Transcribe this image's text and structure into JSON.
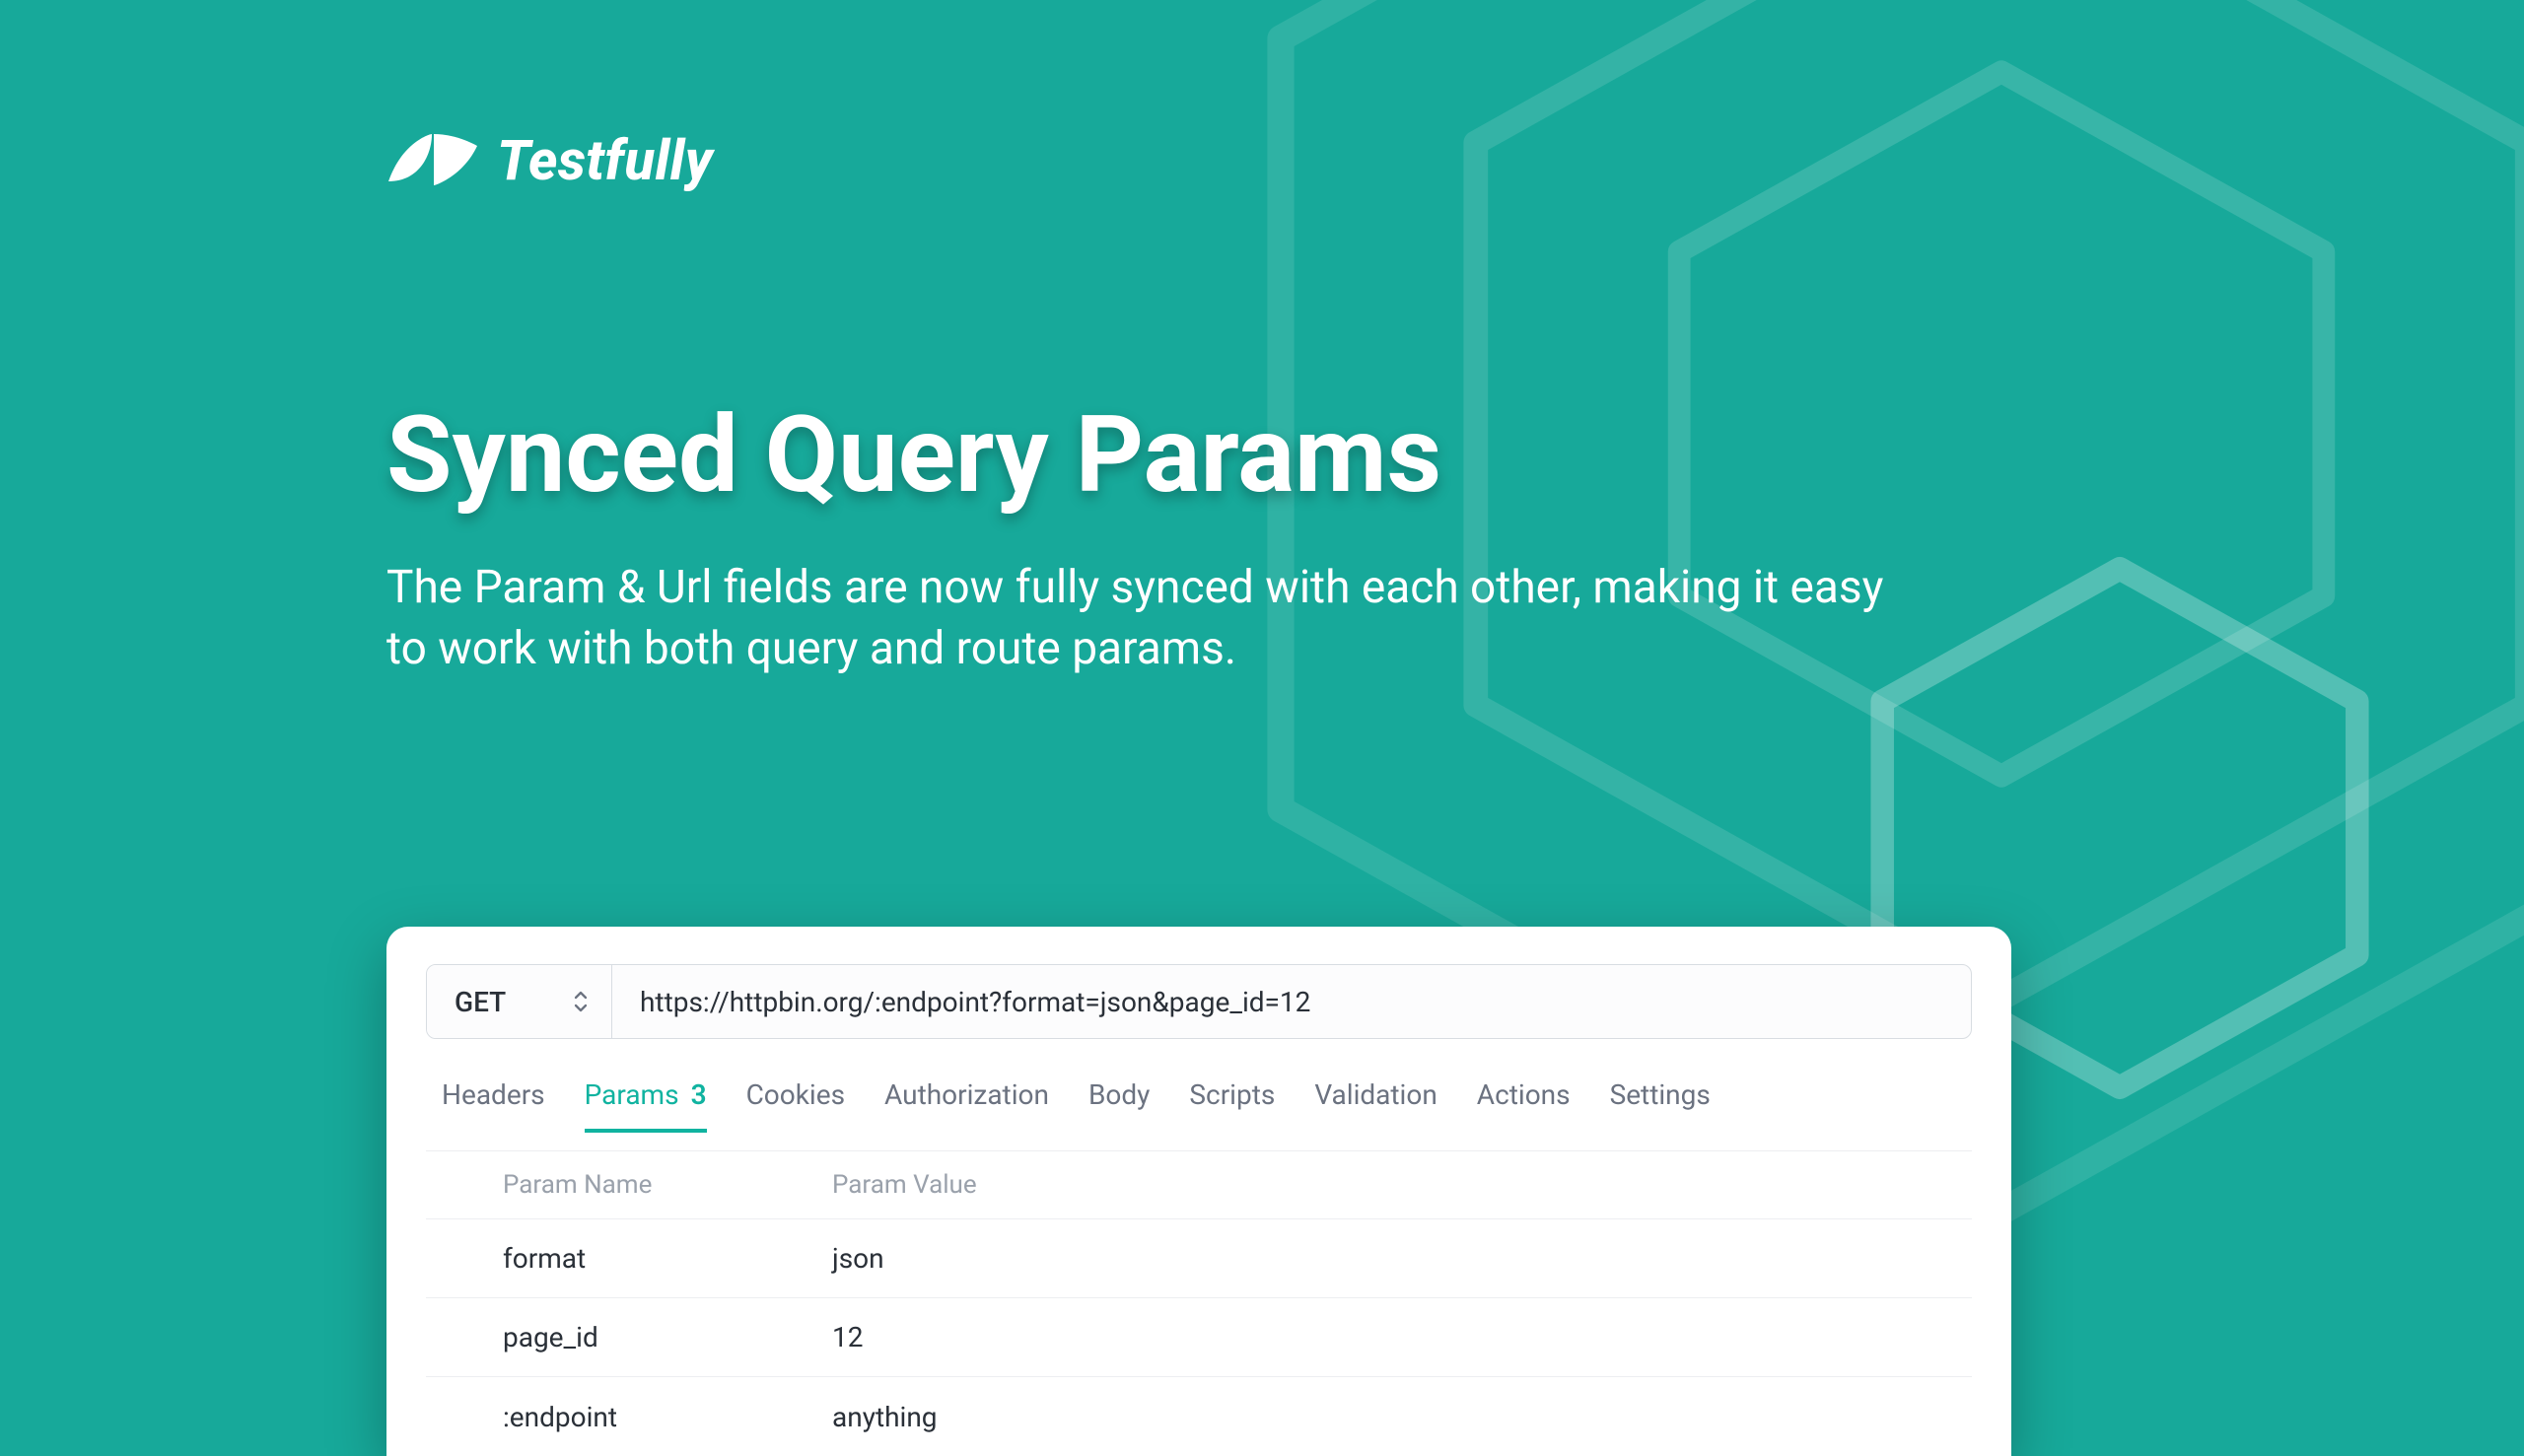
{
  "brand": {
    "name": "Testfully"
  },
  "headline": "Synced Query Params",
  "subcopy": "The Param & Url fields are now fully synced with each other, making it easy to work with both query and route params.",
  "request": {
    "method": "GET",
    "url": "https://httpbin.org/:endpoint?format=json&page_id=12"
  },
  "tabs": {
    "items": [
      {
        "label": "Headers"
      },
      {
        "label": "Params",
        "count": "3",
        "active": true
      },
      {
        "label": "Cookies"
      },
      {
        "label": "Authorization"
      },
      {
        "label": "Body"
      },
      {
        "label": "Scripts"
      },
      {
        "label": "Validation"
      },
      {
        "label": "Actions"
      },
      {
        "label": "Settings"
      }
    ]
  },
  "paramsTable": {
    "headers": {
      "name": "Param Name",
      "value": "Param Value"
    },
    "rows": [
      {
        "name": "format",
        "value": "json"
      },
      {
        "name": "page_id",
        "value": "12"
      },
      {
        "name": ":endpoint",
        "value": "anything"
      }
    ]
  },
  "colors": {
    "background": "#17a99a",
    "accent": "#10b3a0"
  }
}
